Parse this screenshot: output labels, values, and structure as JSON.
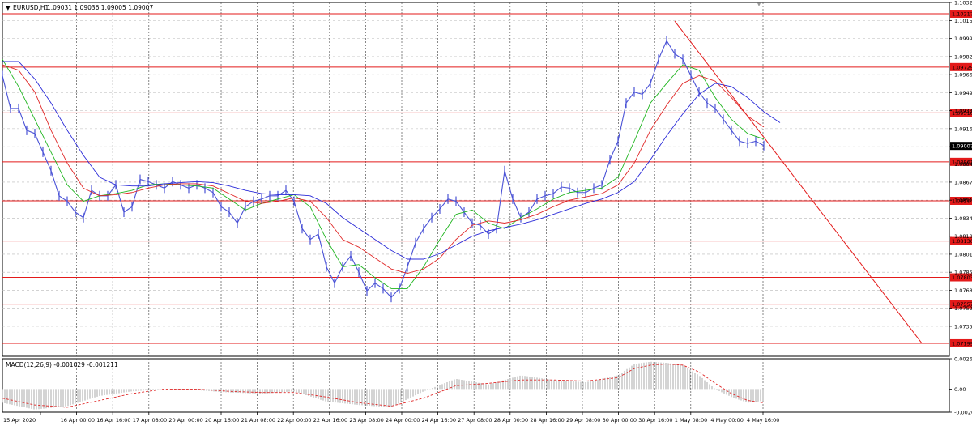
{
  "colors": {
    "background": "#ffffff",
    "grid": "#b8b8b8",
    "price_line": "#4a52d6",
    "ma_fast": "#1fb51f",
    "ma_mid": "#e02828",
    "ma_slow": "#2a2ad8",
    "level": "#e31a1a",
    "trend": "#e31a1a",
    "macd_hist": "#a8a8a8",
    "macd_signal": "#e02828",
    "current_price_bg": "#000000",
    "axis_text": "#000000"
  },
  "chart_data": [
    {
      "type": "line",
      "symbol_label": "EURUSD,H1",
      "ohlc_text": "1.09031 1.09036 1.09005 1.09007",
      "ylim": [
        1.0708,
        1.10321
      ],
      "y_ticks": [
        "1.10321",
        "1.10155",
        "1.09990",
        "1.09825",
        "1.09660",
        "1.09495",
        "1.09330",
        "1.09165",
        "1.09000",
        "1.08840",
        "1.08675",
        "1.08510",
        "1.08345",
        "1.08180",
        "1.08015",
        "1.07850",
        "1.07685",
        "1.07520",
        "1.07355"
      ],
      "x_labels": [
        "15 Apr 2020",
        "16 Apr 00:00",
        "16 Apr 16:00",
        "17 Apr 08:00",
        "20 Apr 00:00",
        "20 Apr 16:00",
        "21 Apr 08:00",
        "22 Apr 00:00",
        "22 Apr 16:00",
        "23 Apr 08:00",
        "24 Apr 00:00",
        "24 Apr 16:00",
        "27 Apr 08:00",
        "28 Apr 00:00",
        "28 Apr 16:00",
        "29 Apr 08:00",
        "30 Apr 00:00",
        "30 Apr 16:00",
        "1 May 08:00",
        "4 May 00:00",
        "4 May 16:00"
      ],
      "current_price": "1.09007",
      "levels": [
        {
          "label": "1.10217",
          "value": 1.10217
        },
        {
          "label": "1.09729",
          "value": 1.09729
        },
        {
          "label": "1.09310",
          "value": 1.0931
        },
        {
          "label": "1.08861",
          "value": 1.08861
        },
        {
          "label": "1.08504",
          "value": 1.08504
        },
        {
          "label": "1.08136",
          "value": 1.08136
        },
        {
          "label": "1.07803",
          "value": 1.07803
        },
        {
          "label": "1.07557",
          "value": 1.07557
        },
        {
          "label": "1.07199",
          "value": 1.07199
        }
      ],
      "series": [
        {
          "role": "price",
          "x": [
            0,
            10,
            20,
            30,
            40,
            50,
            60,
            70,
            80,
            90,
            100,
            110,
            120,
            130,
            140,
            150,
            160,
            170,
            180,
            190,
            200,
            210,
            220,
            230,
            240,
            250,
            260,
            270,
            280,
            290,
            300,
            310,
            320,
            330,
            340,
            350,
            360,
            370,
            380,
            390,
            400,
            410,
            420,
            430,
            440,
            450,
            460,
            470,
            480,
            490,
            500,
            510,
            520,
            530,
            540,
            550,
            560,
            570,
            580,
            590,
            600,
            610,
            620,
            630,
            640,
            650,
            660,
            670,
            680,
            690,
            700,
            710,
            720,
            730,
            740,
            750,
            760,
            770,
            780,
            790,
            800,
            810,
            820,
            830,
            840,
            850,
            860,
            870,
            880,
            890,
            900,
            910,
            920,
            930,
            940
          ],
          "y": [
            1.0965,
            1.0935,
            1.0935,
            1.0915,
            1.0912,
            1.0895,
            1.0878,
            1.0855,
            1.085,
            1.084,
            1.0835,
            1.086,
            1.0855,
            1.0855,
            1.0865,
            1.084,
            1.0845,
            1.087,
            1.0868,
            1.0865,
            1.0862,
            1.0868,
            1.0865,
            1.0862,
            1.0865,
            1.0862,
            1.0858,
            1.0845,
            1.084,
            1.083,
            1.0845,
            1.085,
            1.0852,
            1.0855,
            1.0855,
            1.086,
            1.085,
            1.0825,
            1.0815,
            1.082,
            1.079,
            1.0775,
            1.079,
            1.08,
            1.0785,
            1.0768,
            1.0775,
            1.077,
            1.0762,
            1.077,
            1.079,
            1.0812,
            1.0825,
            1.0835,
            1.0843,
            1.0852,
            1.085,
            1.084,
            1.083,
            1.0828,
            1.082,
            1.0825,
            1.0878,
            1.0852,
            1.0835,
            1.084,
            1.0852,
            1.0855,
            1.0857,
            1.0863,
            1.0862,
            1.0858,
            1.0858,
            1.0862,
            1.0865,
            1.0888,
            1.0905,
            1.094,
            1.095,
            1.0948,
            1.0958,
            1.098,
            1.0997,
            1.0985,
            1.098,
            1.0965,
            1.095,
            1.094,
            1.0935,
            1.0925,
            1.0915,
            1.0905,
            1.0903,
            1.0905,
            1.0901
          ]
        },
        {
          "role": "ma_fast",
          "x": [
            0,
            20,
            40,
            60,
            80,
            100,
            120,
            140,
            160,
            180,
            200,
            220,
            240,
            260,
            280,
            300,
            320,
            340,
            360,
            380,
            400,
            420,
            440,
            460,
            480,
            500,
            520,
            540,
            560,
            580,
            600,
            620,
            640,
            660,
            680,
            700,
            720,
            740,
            760,
            780,
            800,
            820,
            840,
            860,
            880,
            900,
            920,
            940
          ],
          "y": [
            1.098,
            1.0955,
            1.0925,
            1.0895,
            1.0865,
            1.085,
            1.0855,
            1.0857,
            1.086,
            1.0865,
            1.0866,
            1.0865,
            1.0864,
            1.0862,
            1.0852,
            1.0842,
            1.0848,
            1.0852,
            1.0856,
            1.0845,
            1.0815,
            1.079,
            1.0792,
            1.078,
            1.077,
            1.077,
            1.079,
            1.0815,
            1.0838,
            1.0842,
            1.083,
            1.0825,
            1.0835,
            1.0843,
            1.0852,
            1.0858,
            1.086,
            1.0862,
            1.0872,
            1.0905,
            1.094,
            1.0958,
            1.0975,
            1.097,
            1.0945,
            1.0925,
            1.0912,
            1.0907
          ]
        },
        {
          "role": "ma_mid",
          "x": [
            0,
            20,
            40,
            60,
            80,
            100,
            120,
            140,
            160,
            180,
            200,
            220,
            240,
            260,
            280,
            300,
            320,
            340,
            360,
            380,
            400,
            420,
            440,
            460,
            480,
            500,
            520,
            540,
            560,
            580,
            600,
            620,
            640,
            660,
            680,
            700,
            720,
            740,
            760,
            780,
            800,
            820,
            840,
            860,
            880,
            900,
            920,
            940
          ],
          "y": [
            1.0975,
            1.097,
            1.095,
            1.0915,
            1.0885,
            1.0862,
            1.0855,
            1.0856,
            1.0858,
            1.0862,
            1.0865,
            1.0866,
            1.0866,
            1.0864,
            1.0857,
            1.085,
            1.0848,
            1.085,
            1.0853,
            1.085,
            1.0835,
            1.0815,
            1.0808,
            1.0798,
            1.0788,
            1.0784,
            1.0788,
            1.0798,
            1.0815,
            1.0828,
            1.0832,
            1.083,
            1.0833,
            1.0838,
            1.0845,
            1.0851,
            1.0854,
            1.0857,
            1.0865,
            1.0885,
            1.0915,
            1.0938,
            1.0958,
            1.0965,
            1.096,
            1.0945,
            1.0928,
            1.0918
          ]
        },
        {
          "role": "ma_slow",
          "x": [
            0,
            20,
            40,
            60,
            80,
            100,
            120,
            140,
            160,
            180,
            200,
            220,
            240,
            260,
            280,
            300,
            320,
            340,
            360,
            380,
            400,
            420,
            440,
            460,
            480,
            500,
            520,
            540,
            560,
            580,
            600,
            620,
            640,
            660,
            680,
            700,
            720,
            740,
            760,
            780,
            800,
            820,
            840,
            860,
            880,
            900,
            920,
            940,
            960
          ],
          "y": [
            1.0978,
            1.0978,
            1.0962,
            1.094,
            1.0915,
            1.0892,
            1.0872,
            1.0865,
            1.0864,
            1.0864,
            1.0866,
            1.0867,
            1.0868,
            1.0867,
            1.0864,
            1.086,
            1.0857,
            1.0856,
            1.0856,
            1.0855,
            1.0848,
            1.0835,
            1.0825,
            1.0815,
            1.0805,
            1.0797,
            1.0797,
            1.0802,
            1.081,
            1.0818,
            1.0823,
            1.0826,
            1.0829,
            1.0833,
            1.0838,
            1.0843,
            1.0848,
            1.0852,
            1.0858,
            1.0868,
            1.0888,
            1.091,
            1.093,
            1.0948,
            1.0958,
            1.0955,
            1.0945,
            1.0932,
            1.0922
          ]
        }
      ],
      "trendline": {
        "x": [
          830,
          1135
        ],
        "y": [
          1.1015,
          1.072
        ]
      }
    },
    {
      "type": "line",
      "indicator_label": "MACD(12,26,9) -0.001029 -0.001211",
      "ylim": [
        -0.00203,
        0.00266
      ],
      "y_ticks": [
        "0.00266",
        "0.00",
        "-0.00203"
      ],
      "series": [
        {
          "role": "macd_histogram",
          "x": [
            0,
            40,
            80,
            120,
            160,
            200,
            240,
            280,
            320,
            360,
            400,
            440,
            480,
            520,
            560,
            600,
            640,
            680,
            720,
            760,
            780,
            800,
            820,
            840,
            860,
            880,
            900,
            920,
            940
          ],
          "y": [
            -0.0012,
            -0.0018,
            -0.0015,
            -0.0006,
            -0.0002,
            0.0,
            -0.0001,
            -0.0003,
            -0.0004,
            -0.0002,
            -0.0011,
            -0.0014,
            -0.0016,
            -0.0002,
            0.0009,
            0.0004,
            0.0012,
            0.0008,
            0.0006,
            0.0012,
            0.0022,
            0.0024,
            0.0023,
            0.0021,
            0.0012,
            0.0,
            -0.0007,
            -0.0012,
            -0.001029
          ]
        },
        {
          "role": "macd_signal",
          "x": [
            0,
            40,
            80,
            120,
            160,
            200,
            240,
            280,
            320,
            360,
            400,
            440,
            480,
            520,
            560,
            600,
            640,
            680,
            720,
            760,
            780,
            800,
            820,
            840,
            860,
            880,
            900,
            920,
            940
          ],
          "y": [
            -0.0008,
            -0.0014,
            -0.0016,
            -0.001,
            -0.0004,
            0.0,
            0.0,
            -0.0002,
            -0.0003,
            -0.0003,
            -0.0007,
            -0.0012,
            -0.0015,
            -0.0008,
            0.0003,
            0.0005,
            0.0008,
            0.0008,
            0.0007,
            0.001,
            0.0018,
            0.0021,
            0.0022,
            0.0021,
            0.0015,
            0.0005,
            -0.0004,
            -0.001,
            -0.001211
          ]
        }
      ]
    }
  ]
}
